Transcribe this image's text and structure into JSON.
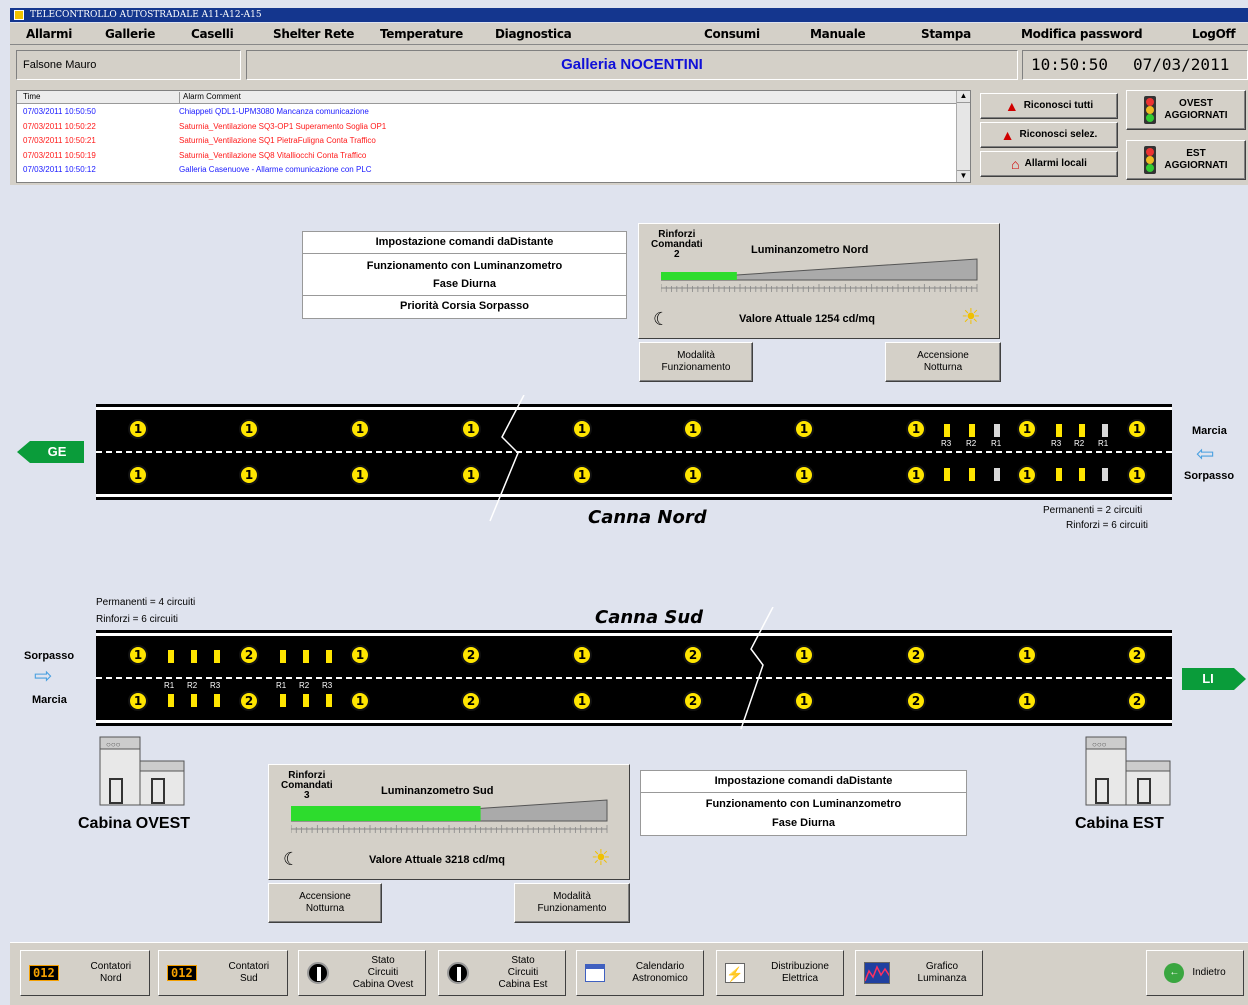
{
  "window": {
    "title": "TELECONTROLLO AUTOSTRADALE A11-A12-A15"
  },
  "menu": [
    "Allarmi",
    "Gallerie",
    "Caselli",
    "Shelter Rete",
    "Temperature",
    "Diagnostica",
    "Consumi",
    "Manuale",
    "Stampa",
    "Modifica password",
    "LogOff"
  ],
  "header": {
    "user": "Falsone Mauro",
    "title": "Galleria NOCENTINI",
    "time": "10:50:50",
    "date": "07/03/2011"
  },
  "alarms": {
    "col_time": "Time",
    "col_comment": "Alarm Comment",
    "rows": [
      {
        "time": "07/03/2011 10:50:50",
        "comment": "Chiappeti QDL1-UPM3080 Mancanza comunicazione",
        "color": "#1a1aff"
      },
      {
        "time": "07/03/2011 10:50:22",
        "comment": "Saturnia_Ventilazione SQ3-OP1 Superamento Soglia OP1",
        "color": "#ff1a1a"
      },
      {
        "time": "07/03/2011 10:50:21",
        "comment": "Saturnia_Ventilazione SQ1 PietraFuligna Conta Traffico",
        "color": "#ff1a1a"
      },
      {
        "time": "07/03/2011 10:50:19",
        "comment": "Saturnia_Ventilazione SQ8 Vitalliocchi Conta Traffico",
        "color": "#ff1a1a"
      },
      {
        "time": "07/03/2011 10:50:12",
        "comment": "Galleria Casenuove - Allarme comunicazione con PLC",
        "color": "#1a1aff"
      }
    ]
  },
  "alarm_buttons": {
    "ack_all": "Riconosci tutti",
    "ack_sel": "Riconosci selez.",
    "local": "Allarmi locali"
  },
  "status": {
    "ovest": "OVEST",
    "est": "EST",
    "updated": "AGGIORNATI"
  },
  "nord": {
    "settings": [
      "Impostazione comandi daDistante",
      "Funzionamento con Luminanzometro",
      "Fase Diurna",
      "Priorità Corsia Sorpasso"
    ],
    "lum": {
      "rinforzi": "Rinforzi",
      "comandati": "Comandati",
      "count": "2",
      "title": "Luminanzometro Nord",
      "value": "Valore Attuale  1254 cd/mq",
      "level": 0.24
    },
    "btn_mode": "Modalità\nFunzionamento",
    "btn_night": "Accensione\nNotturna",
    "label": "Canna Nord",
    "note1": "Permanenti = 2 circuiti",
    "note2": "Rinforzi = 6 circuiti",
    "sign": "GE",
    "right_top": "Marcia",
    "right_bottom": "Sorpasso",
    "lamp_value": "1",
    "r_labels": [
      "R3",
      "R2",
      "R1",
      "R3",
      "R2",
      "R1"
    ]
  },
  "sud": {
    "label": "Canna Sud",
    "note1": "Permanenti = 4 circuiti",
    "note2": "Rinforzi = 6 circuiti",
    "sign": "LI",
    "left_top": "Sorpasso",
    "left_bottom": "Marcia",
    "lamps_top": [
      "1",
      "2",
      "1",
      "2",
      "1",
      "2",
      "1",
      "2",
      "1",
      "2"
    ],
    "lamps_bottom": [
      "1",
      "2",
      "1",
      "2",
      "1",
      "2",
      "1",
      "2",
      "1",
      "2"
    ],
    "r_labels": [
      "R1",
      "R2",
      "R3",
      "R1",
      "R2",
      "R3"
    ],
    "lum": {
      "rinforzi": "Rinforzi",
      "comandati": "Comandati",
      "count": "3",
      "title": "Luminanzometro Sud",
      "value": "Valore Attuale  3218 cd/mq",
      "level": 0.6
    },
    "settings": [
      "Impostazione comandi daDistante",
      "Funzionamento con Luminanzometro",
      "Fase Diurna"
    ],
    "btn_night": "Accensione\nNotturna",
    "btn_mode": "Modalità\nFunzionamento"
  },
  "cabins": {
    "ovest": "Cabina OVEST",
    "est": "Cabina EST"
  },
  "footer": [
    {
      "label": "Contatori\nNord",
      "icon": "counter-icon",
      "counter": "012"
    },
    {
      "label": "Contatori\nSud",
      "icon": "counter-icon",
      "counter": "012"
    },
    {
      "label": "Stato\nCircuiti\nCabina Ovest",
      "icon": "circuit-icon"
    },
    {
      "label": "Stato\nCircuiti\nCabina Est",
      "icon": "circuit-icon"
    },
    {
      "label": "Calendario\nAstronomico",
      "icon": "calendar-icon"
    },
    {
      "label": "Distribuzione\nElettrica",
      "icon": "electric-icon"
    },
    {
      "label": "Grafico\nLuminanza",
      "icon": "graph-icon"
    }
  ],
  "back": "Indietro"
}
